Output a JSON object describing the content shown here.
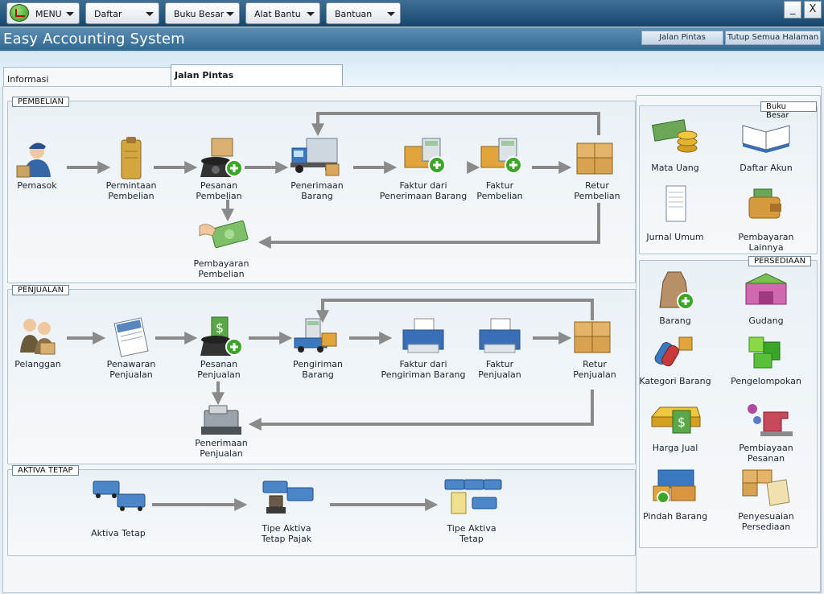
{
  "menubar": {
    "menu": "MENU",
    "daftar": "Daftar",
    "buku_besar": "Buku Besar",
    "alat_bantu": "Alat Bantu",
    "bantuan": "Bantuan",
    "minimize": "_",
    "close": "X"
  },
  "app_title": "Easy Accounting System",
  "title_buttons": {
    "jalan_pintas": "Jalan Pintas",
    "tutup_semua": "Tutup Semua Halaman"
  },
  "tabs": {
    "informasi": "Informasi",
    "jalan_pintas": "Jalan Pintas"
  },
  "pembelian": {
    "title": "PEMBELIAN",
    "pemasok": "Pemasok",
    "permintaan": [
      "Permintaan",
      "Pembelian"
    ],
    "pesanan": [
      "Pesanan",
      "Pembelian"
    ],
    "penerimaan": [
      "Penerimaan",
      "Barang"
    ],
    "faktur_penerimaan": [
      "Faktur dari",
      "Penerimaan Barang"
    ],
    "faktur": [
      "Faktur",
      "Pembelian"
    ],
    "retur": [
      "Retur",
      "Pembelian"
    ],
    "pembayaran": [
      "Pembayaran",
      "Pembelian"
    ]
  },
  "penjualan": {
    "title": "PENJUALAN",
    "pelanggan": "Pelanggan",
    "penawaran": [
      "Penawaran",
      "Penjualan"
    ],
    "pesanan": [
      "Pesanan",
      "Penjualan"
    ],
    "pengiriman": [
      "Pengiriman",
      "Barang"
    ],
    "faktur_pengiriman": [
      "Faktur dari",
      "Pengiriman Barang"
    ],
    "faktur": [
      "Faktur",
      "Penjualan"
    ],
    "retur": [
      "Retur",
      "Penjualan"
    ],
    "penerimaan": [
      "Penerimaan",
      "Penjualan"
    ]
  },
  "aktiva": {
    "title": "AKTIVA TETAP",
    "aktiva_tetap": "Aktiva Tetap",
    "tipe_pajak": [
      "Tipe Aktiva",
      "Tetap Pajak"
    ],
    "tipe": [
      "Tipe Aktiva",
      "Tetap"
    ]
  },
  "buku_besar": {
    "title": "Buku Besar",
    "mata_uang": "Mata Uang",
    "daftar_akun": "Daftar Akun",
    "jurnal_umum": "Jurnal Umum",
    "pembayaran_lainnya": "Pembayaran Lainnya"
  },
  "persediaan": {
    "title": "PERSEDIAAN",
    "barang": "Barang",
    "gudang": "Gudang",
    "kategori_barang": "Kategori Barang",
    "pengelompokan": "Pengelompokan",
    "harga_jual": "Harga Jual",
    "pembiayaan_pesanan": "Pembiayaan Pesanan",
    "pindah_barang": "Pindah Barang",
    "penyesuaian_persediaan": "Penyesuaian Persediaan"
  },
  "colors": {
    "arrow": "#8a8a8a",
    "accent": "#2e6890",
    "plus": "#3aa628"
  }
}
